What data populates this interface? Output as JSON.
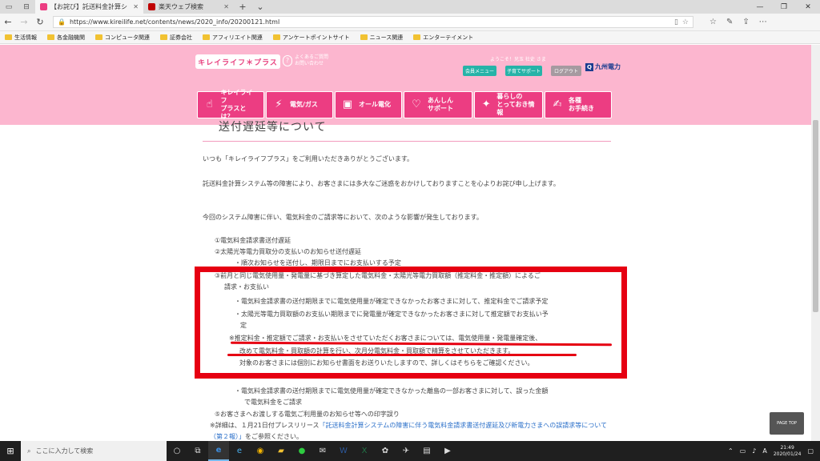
{
  "browser": {
    "tabs": [
      {
        "title": "【お詫び】託送料金計算シ",
        "active": true
      },
      {
        "title": "楽天ウェブ検索",
        "active": false
      }
    ],
    "url": "https://www.kireilife.net/contents/news/2020_info/20200121.html",
    "bookmarks": [
      "生活情報",
      "各金融機関",
      "コンピュータ関連",
      "証券会社",
      "アフィリエイト関連",
      "アンケートポイントサイト",
      "ニュース関連",
      "エンターテイメント"
    ]
  },
  "header": {
    "logo": "キレイライフ＊プラス",
    "faq_line1": "よくあるご質問",
    "faq_line2": "お問い合わせ",
    "welcome": "ようこそ！兄玉 社史 さま",
    "member_menu": "会員メニュー",
    "child_support": "子育てサポート",
    "logout": "ログアウト",
    "brand": "九州電力"
  },
  "nav": {
    "items": [
      {
        "line1": "キレイライフ",
        "line2": "プラスとは？"
      },
      {
        "line1": "電気/ガス",
        "line2": ""
      },
      {
        "line1": "オール電化",
        "line2": ""
      },
      {
        "line1": "あんしん",
        "line2": "サポート"
      },
      {
        "line1": "暮らしの",
        "line2": "とっておき情報"
      },
      {
        "line1": "各種",
        "line2": "お手続き"
      }
    ]
  },
  "article": {
    "title": "送付遅延等について",
    "greeting": "いつも「キレイライフプラス」をご利用いただきありがとうございます。",
    "apology": "託送料金計算システム等の障害により、お客さまには多大なご迷惑をおかけしておりますことを心よりお詫び申し上げます。",
    "intro": "今回のシステム障害に伴い、電気料金のご請求等において、次のような影響が発生しております。",
    "item1": "①電気料金請求書送付遅延",
    "item2": "②太陽光等電力買取分の支払いのお知らせ送付遅延",
    "item2_sub": "・順次お知らせを送付し、期限日までにお支払いする予定",
    "item3_line1": "③前月と同じ電気使用量・発電量に基づき算定した電気料金・太陽光等電力買取額（推定料金・推定額）によるご",
    "item3_line2": "請求・お支払い",
    "bullet1": "・電気料金請求書の送付期限までに電気使用量が確定できなかったお客さまに対して、推定料金でご請求予定",
    "bullet2_line1": "・太陽光等電力買取額のお支払い期限までに発電量が確定できなかったお客さまに対して推定額でお支払い予",
    "bullet2_line2": "定",
    "note_line1": "※推定料金・推定額でご請求・お支払いをさせていただくお客さまについては、電気使用量・発電量確定後、",
    "note_line2": "改めて電気料金・買取額の計算を行い、次月分電気料金・買取額で精算をさせていただきます。",
    "note_line3": "対象のお客さまには個別にお知らせ書面をお送りいたしますので、詳しくはそちらをご確認ください。",
    "item4_bullet_line1": "・電気料金請求書の送付期限までに電気使用量が確定できなかった離島の一部お客さまに対して、誤った金額",
    "item4_bullet_line2": "で電気料金をご請求",
    "item5": "⑤お客さまへお渡しする電気ご利用量のお知らせ等への印字誤り",
    "detail_prefix": "※詳細は、１月21日付プレスリリース",
    "detail_link": "「託送料金計算システムの障害に伴う電気料金請求書送付遅延及び新電力さまへの誤請求等について（第２報）」",
    "detail_suffix": "をご参照ください。"
  },
  "page_top": "PAGE TOP",
  "taskbar": {
    "search_placeholder": "ここに入力して検索",
    "time": "21:49",
    "date": "2020/01/24"
  }
}
